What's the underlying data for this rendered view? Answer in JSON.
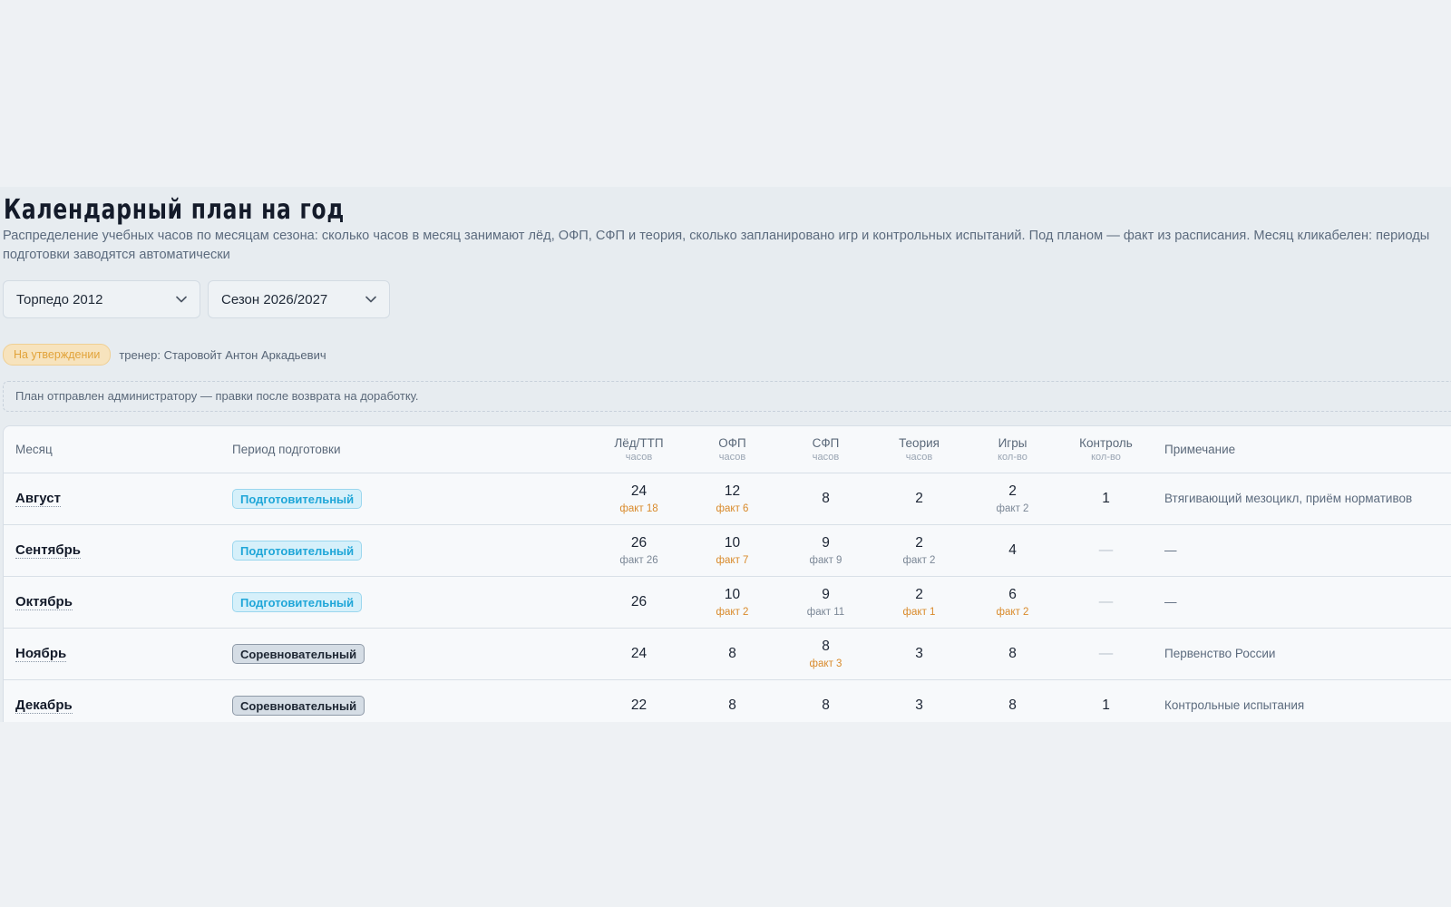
{
  "page": {
    "title": "Календарный план на год",
    "description": "Распределение учебных часов по месяцам сезона: сколько часов в месяц занимают лёд, ОФП, СФП и теория, сколько запланировано игр и контрольных испытаний. Под планом — факт из расписания. Месяц кликабелен: периоды подготовки заводятся автоматически"
  },
  "filters": {
    "team": "Торпедо 2012",
    "season": "Сезон 2026/2027"
  },
  "status": {
    "badge": "На утверждении",
    "coach": "тренер: Старовойт Антон Аркадьевич",
    "notice": "План отправлен администратору — правки после возврата на доработку."
  },
  "colors": {
    "status_badge": "#e2a33a",
    "phase_prep": "#1fa6d8",
    "phase_comp": "#1d2633",
    "fact_deviation": "#d98a2b",
    "fact_match": "#7b8796"
  },
  "table": {
    "headers": {
      "month": "Месяц",
      "period": "Период подготовки",
      "ice": "Лёд/ТТП",
      "ice_unit": "часов",
      "ofp": "ОФП",
      "ofp_unit": "часов",
      "sfp": "СФП",
      "sfp_unit": "часов",
      "theory": "Теория",
      "theory_unit": "часов",
      "games": "Игры",
      "games_unit": "кол-во",
      "control": "Контроль",
      "control_unit": "кол-во",
      "note": "Примечание"
    },
    "rows": [
      {
        "month": "Август",
        "period": "Подготовительный",
        "ice": "24",
        "ice_fact": "факт 18",
        "ofp": "12",
        "ofp_fact": "факт 6",
        "sfp": "8",
        "sfp_fact": "",
        "theory": "2",
        "theory_fact": "",
        "games": "2",
        "games_fact": "факт 2",
        "control": "1",
        "note": "Втягивающий мезоцикл, приём нормативов"
      },
      {
        "month": "Сентябрь",
        "period": "Подготовительный",
        "ice": "26",
        "ice_fact": "факт 26",
        "ofp": "10",
        "ofp_fact": "факт 7",
        "sfp": "9",
        "sfp_fact": "факт 9",
        "theory": "2",
        "theory_fact": "факт 2",
        "games": "4",
        "games_fact": "",
        "control": "—",
        "note": "—"
      },
      {
        "month": "Октябрь",
        "period": "Подготовительный",
        "ice": "26",
        "ice_fact": "",
        "ofp": "10",
        "ofp_fact": "факт 2",
        "sfp": "9",
        "sfp_fact": "факт 11",
        "theory": "2",
        "theory_fact": "факт 1",
        "games": "6",
        "games_fact": "факт 2",
        "control": "—",
        "note": "—"
      },
      {
        "month": "Ноябрь",
        "period": "Соревновательный",
        "ice": "24",
        "ice_fact": "",
        "ofp": "8",
        "ofp_fact": "",
        "sfp": "8",
        "sfp_fact": "факт 3",
        "theory": "3",
        "theory_fact": "",
        "games": "8",
        "games_fact": "",
        "control": "—",
        "note": "Первенство России"
      },
      {
        "month": "Декабрь",
        "period": "Соревновательный",
        "ice": "22",
        "ice_fact": "",
        "ofp": "8",
        "ofp_fact": "",
        "sfp": "8",
        "sfp_fact": "",
        "theory": "3",
        "theory_fact": "",
        "games": "8",
        "games_fact": "",
        "control": "1",
        "note": "Контрольные испытания"
      }
    ]
  }
}
